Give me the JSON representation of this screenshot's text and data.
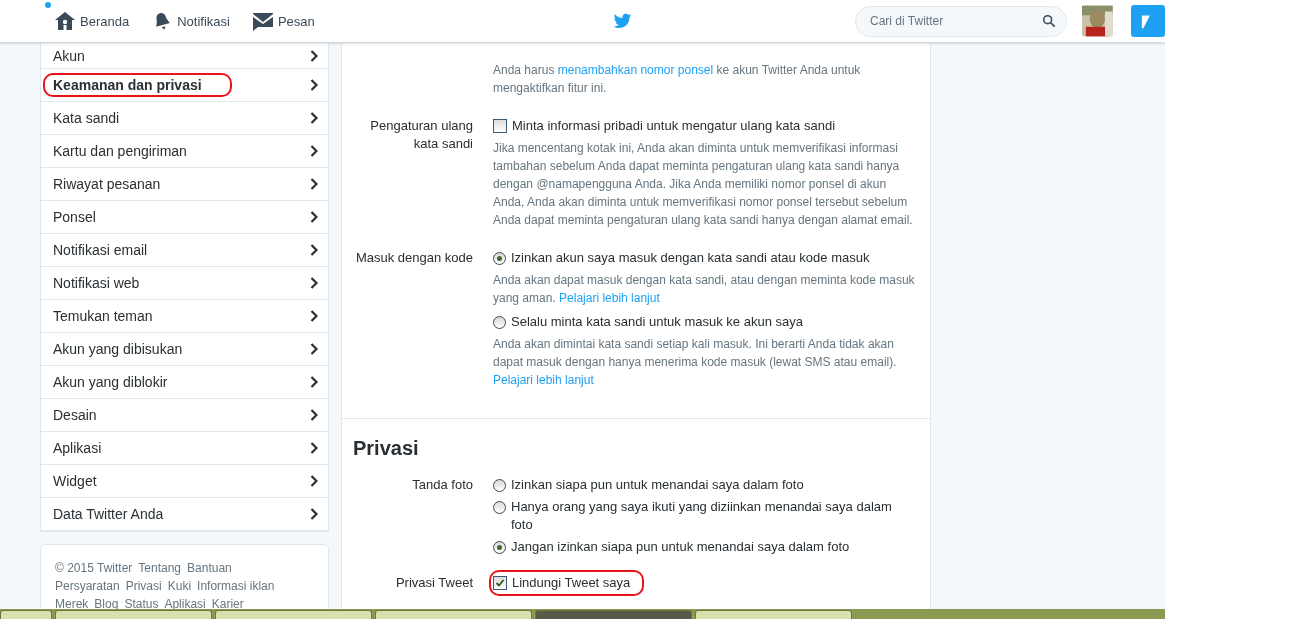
{
  "nav": {
    "items": [
      {
        "label": "Beranda",
        "has_dot": true
      },
      {
        "label": "Notifikasi",
        "has_dot": false
      },
      {
        "label": "Pesan",
        "has_dot": false
      }
    ],
    "search": {
      "placeholder": "Cari di Twitter"
    }
  },
  "sidebar": {
    "items": [
      {
        "label": "Akun",
        "selected": false,
        "highlighted": false
      },
      {
        "label": "Keamanan dan privasi",
        "selected": true,
        "highlighted": true
      },
      {
        "label": "Kata sandi",
        "selected": false,
        "highlighted": false
      },
      {
        "label": "Kartu dan pengiriman",
        "selected": false,
        "highlighted": false
      },
      {
        "label": "Riwayat pesanan",
        "selected": false,
        "highlighted": false
      },
      {
        "label": "Ponsel",
        "selected": false,
        "highlighted": false
      },
      {
        "label": "Notifikasi email",
        "selected": false,
        "highlighted": false
      },
      {
        "label": "Notifikasi web",
        "selected": false,
        "highlighted": false
      },
      {
        "label": "Temukan teman",
        "selected": false,
        "highlighted": false
      },
      {
        "label": "Akun yang dibisukan",
        "selected": false,
        "highlighted": false
      },
      {
        "label": "Akun yang diblokir",
        "selected": false,
        "highlighted": false
      },
      {
        "label": "Desain",
        "selected": false,
        "highlighted": false
      },
      {
        "label": "Aplikasi",
        "selected": false,
        "highlighted": false
      },
      {
        "label": "Widget",
        "selected": false,
        "highlighted": false
      },
      {
        "label": "Data Twitter Anda",
        "selected": false,
        "highlighted": false
      }
    ],
    "footer": [
      [
        "© 2015 Twitter",
        "Tentang",
        "Bantuan"
      ],
      [
        "Persyaratan",
        "Privasi",
        "Kuki",
        "Informasi iklan"
      ],
      [
        "Merek",
        "Blog",
        "Status",
        "Aplikasi",
        "Karier"
      ]
    ]
  },
  "sections": [
    {
      "rows": [
        {
          "items": [
            {
              "kind": "note",
              "parts": [
                {
                  "text": "Anda harus ",
                  "kind": "text"
                },
                {
                  "text": "menambahkan nomor ponsel",
                  "kind": "link"
                },
                {
                  "text": " ke akun Twitter Anda untuk mengaktifkan fitur ini.",
                  "kind": "text"
                }
              ]
            }
          ]
        },
        {
          "label": "Pengaturan ulang kata sandi",
          "items": [
            {
              "kind": "checkbox",
              "label": "Minta informasi pribadi untuk mengatur ulang kata sandi",
              "checked": false,
              "highlighted": false
            },
            {
              "kind": "note",
              "parts": [
                {
                  "text": "Jika mencentang kotak ini, Anda akan diminta untuk memverifikasi informasi tambahan sebelum Anda dapat meminta pengaturan ulang kata sandi hanya dengan @namapengguna Anda. Jika Anda memiliki nomor ponsel di akun Anda, Anda akan diminta untuk memverifikasi nomor ponsel tersebut sebelum Anda dapat meminta pengaturan ulang kata sandi hanya dengan alamat email.",
                  "kind": "text"
                }
              ]
            }
          ]
        },
        {
          "label": "Masuk dengan kode",
          "items": [
            {
              "kind": "radio",
              "label": "Izinkan akun saya masuk dengan kata sandi atau kode masuk",
              "selected": true
            },
            {
              "kind": "note",
              "parts": [
                {
                  "text": "Anda akan dapat masuk dengan kata sandi, atau dengan meminta kode masuk yang aman. ",
                  "kind": "text"
                },
                {
                  "text": "Pelajari lebih lanjut",
                  "kind": "link"
                }
              ]
            },
            {
              "kind": "radio",
              "label": "Selalu minta kata sandi untuk masuk ke akun saya",
              "selected": false
            },
            {
              "kind": "note",
              "parts": [
                {
                  "text": "Anda akan dimintai kata sandi setiap kali masuk. Ini berarti Anda tidak akan dapat masuk dengan hanya menerima kode masuk (lewat SMS atau email). ",
                  "kind": "text"
                },
                {
                  "text": "Pelajari lebih lanjut",
                  "kind": "link"
                }
              ]
            }
          ]
        }
      ]
    },
    {
      "heading": "Privasi",
      "rows": [
        {
          "label": "Tanda foto",
          "items": [
            {
              "kind": "radio",
              "label": "Izinkan siapa pun untuk menandai saya dalam foto",
              "selected": false
            },
            {
              "kind": "radio",
              "label": "Hanya orang yang saya ikuti yang diziinkan menandai saya dalam foto",
              "selected": false
            },
            {
              "kind": "radio",
              "label": "Jangan izinkan siapa pun untuk menandai saya dalam foto",
              "selected": true
            }
          ]
        },
        {
          "label": "Privasi Tweet",
          "items": [
            {
              "kind": "checkbox",
              "label": "Lindungi Tweet saya",
              "checked": true,
              "highlighted": true
            }
          ]
        }
      ]
    }
  ]
}
